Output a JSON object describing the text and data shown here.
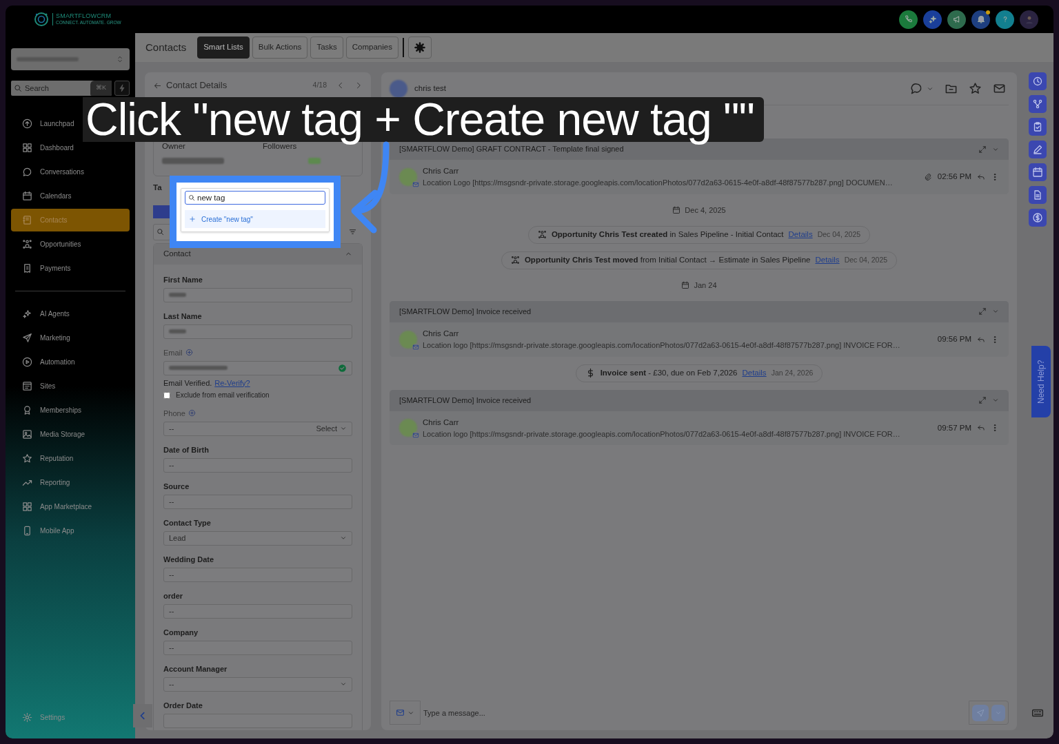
{
  "topbar": {
    "logo": {
      "name": "SMARTFLOWCRM",
      "tagline": "CONNECT. AUTOMATE. GROW"
    },
    "actions": [
      {
        "color": "#1b7a3c",
        "badge": false
      },
      {
        "color": "#1a3f9a",
        "badge": false
      },
      {
        "color": "#2e6b4d",
        "badge": false
      },
      {
        "color": "#1e3f80",
        "badge": true
      },
      {
        "color": "#127f8f",
        "badge": false
      },
      {
        "color": "#2a2340",
        "badge": false
      }
    ]
  },
  "sidebar": {
    "search": {
      "label": "Search",
      "shortcut": "⌘K"
    },
    "items": [
      {
        "label": "Launchpad",
        "selected": false
      },
      {
        "label": "Dashboard",
        "selected": false
      },
      {
        "label": "Conversations",
        "selected": false
      },
      {
        "label": "Calendars",
        "selected": false
      },
      {
        "label": "Contacts",
        "selected": true
      },
      {
        "label": "Opportunities",
        "selected": false
      },
      {
        "label": "Payments",
        "selected": false
      }
    ],
    "items_2": [
      {
        "label": "AI Agents",
        "selected": false
      },
      {
        "label": "Marketing",
        "selected": false
      },
      {
        "label": "Automation",
        "selected": false
      },
      {
        "label": "Sites",
        "selected": false
      },
      {
        "label": "Memberships",
        "selected": false
      },
      {
        "label": "Media Storage",
        "selected": false
      },
      {
        "label": "Reputation",
        "selected": false
      },
      {
        "label": "Reporting",
        "selected": false
      },
      {
        "label": "App Marketplace",
        "selected": false
      },
      {
        "label": "Mobile App",
        "selected": false
      }
    ],
    "settings": "Settings"
  },
  "header": {
    "title": "Contacts",
    "tabs": [
      {
        "label": "Smart Lists",
        "selected": true
      },
      {
        "label": "Bulk Actions",
        "selected": false
      },
      {
        "label": "Tasks",
        "selected": false
      },
      {
        "label": "Companies",
        "selected": false
      }
    ]
  },
  "contact_panel": {
    "title": "Contact Details",
    "position": "4/18",
    "owner_label": "Owner",
    "followers_label": "Followers",
    "tags_label": "Ta",
    "section": "Contact",
    "fields": [
      {
        "kind": "text",
        "label": "First Name",
        "blurred": true
      },
      {
        "kind": "text",
        "label": "Last Name",
        "blurred": true
      },
      {
        "kind": "email",
        "label": "Email",
        "blurred": true,
        "verified": true,
        "status": "Email Verified.",
        "link": "Re-Verify?",
        "option": {
          "label": "Exclude from email verification",
          "checked": false
        }
      },
      {
        "kind": "phone",
        "label": "Phone",
        "value": "--",
        "picker": "Select"
      },
      {
        "kind": "text",
        "label": "Date of Birth",
        "value": "--"
      },
      {
        "kind": "text",
        "label": "Source",
        "value": "--"
      },
      {
        "kind": "select",
        "label": "Contact Type",
        "value": "Lead"
      },
      {
        "kind": "text",
        "label": "Wedding Date",
        "value": "--"
      },
      {
        "kind": "text",
        "label": "order",
        "value": "--"
      },
      {
        "kind": "text",
        "label": "Company",
        "value": "--"
      },
      {
        "kind": "select",
        "label": "Account Manager",
        "value": "--"
      },
      {
        "kind": "text",
        "label": "Order Date"
      }
    ]
  },
  "timeline": {
    "contact_name": "chris test",
    "items": [
      {
        "kind": "email",
        "subject": "[SMARTFLOW Demo] GRAFT CONTRACT - Template final signed",
        "sender": "Chris Carr",
        "preview": "Location Logo [https://msgsndr-private.storage.googleapis.com/locationPhotos/077d2a63-0615-4e0f-a8df-48f87577b287.png] DOCUMEN…",
        "time": "02:56 PM",
        "attachment": true
      },
      {
        "kind": "date",
        "text": "Dec 4, 2025"
      },
      {
        "kind": "activity",
        "text": "**Opportunity Chris Test created** in Sales Pipeline - Initial Contact",
        "link": "Details",
        "date": "Dec 04, 2025"
      },
      {
        "kind": "activity",
        "text": "**Opportunity Chris Test moved** from Initial Contact → Estimate in Sales Pipeline",
        "link": "Details",
        "date": "Dec 04, 2025"
      },
      {
        "kind": "date",
        "text": "Jan 24"
      },
      {
        "kind": "email",
        "subject": "[SMARTFLOW Demo] Invoice received",
        "sender": "Chris Carr",
        "preview": "Location logo [https://msgsndr-private.storage.googleapis.com/locationPhotos/077d2a63-0615-4e0f-a8df-48f87577b287.png] INVOICE FOR…",
        "time": "09:56 PM",
        "attachment": false
      },
      {
        "kind": "invoice",
        "text": "**Invoice sent** - £30, due on Feb 7,2026",
        "link": "Details",
        "date": "Jan 24, 2026"
      },
      {
        "kind": "email",
        "subject": "[SMARTFLOW Demo] Invoice received",
        "sender": "Chris Carr",
        "preview": "Location logo [https://msgsndr-private.storage.googleapis.com/locationPhotos/077d2a63-0615-4e0f-a8df-48f87577b287.png] INVOICE FOR…",
        "time": "09:57 PM",
        "attachment": false
      }
    ],
    "composer": {
      "placeholder": "Type a message..."
    }
  },
  "help_tab": "Need Help?",
  "tutorial": {
    "caption": "Click \"new tag + Create new tag \"\"",
    "search_value": "new tag",
    "option": "Create \"new tag\""
  }
}
